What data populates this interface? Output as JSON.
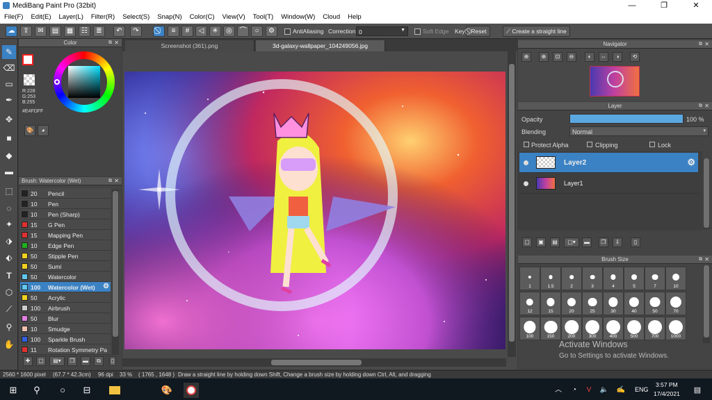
{
  "titlebar": {
    "title": "MediBang Paint Pro (32bit)",
    "minimize": "—",
    "maximize": "❐",
    "close": "✕"
  },
  "menu": [
    "File(F)",
    "Edit(E)",
    "Layer(L)",
    "Filter(R)",
    "Select(S)",
    "Snap(N)",
    "Color(C)",
    "View(V)",
    "Tool(T)",
    "Window(W)",
    "Cloud",
    "Help"
  ],
  "toolbar": {
    "antialiasing": "AntiAliasing",
    "correction_label": "Correction",
    "correction_value": "0",
    "soft_edge": "Soft Edge",
    "key_label": "Key",
    "reset": "Reset",
    "create_straight_line": "Create a straight line"
  },
  "color_panel": {
    "title": "Color",
    "r": "R:228",
    "g": "G:253",
    "b": "B:255",
    "hex": "#E4FDFF",
    "current_color": "#e4fdff"
  },
  "brush_panel": {
    "title": "Brush: Watercolor (Wet)",
    "brushes": [
      {
        "size": "20",
        "name": "Pencil",
        "color": "#222222"
      },
      {
        "size": "10",
        "name": "Pen",
        "color": "#222222"
      },
      {
        "size": "10",
        "name": "Pen (Sharp)",
        "color": "#222222"
      },
      {
        "size": "15",
        "name": "G Pen",
        "color": "#e03030"
      },
      {
        "size": "15",
        "name": "Mapping Pen",
        "color": "#e03030"
      },
      {
        "size": "10",
        "name": "Edge Pen",
        "color": "#20b020"
      },
      {
        "size": "50",
        "name": "Stipple Pen",
        "color": "#f0d020"
      },
      {
        "size": "50",
        "name": "Sumi",
        "color": "#f0d020"
      },
      {
        "size": "50",
        "name": "Watercolor",
        "color": "#60c8f0"
      },
      {
        "size": "100",
        "name": "Watercolor (Wet)",
        "color": "#60c8f0"
      },
      {
        "size": "50",
        "name": "Acrylic",
        "color": "#f0d020"
      },
      {
        "size": "100",
        "name": "Airbrush",
        "color": "#cccccc"
      },
      {
        "size": "50",
        "name": "Blur",
        "color": "#e080e0"
      },
      {
        "size": "10",
        "name": "Smudge",
        "color": "#f0c0b0"
      },
      {
        "size": "100",
        "name": "Sparkle Brush",
        "color": "#3060e0"
      },
      {
        "size": "11",
        "name": "Rotation Symmetry Pa",
        "color": "#e03030"
      }
    ],
    "selected_index": 9
  },
  "tabs": [
    "Screenshot (361).png",
    "3d-galaxy-wallpaper_104249056.jpg"
  ],
  "navigator": {
    "title": "Navigator"
  },
  "layer_panel": {
    "title": "Layer",
    "opacity_label": "Opacity",
    "opacity_value": "100 %",
    "opacity_percent": 100,
    "blending_label": "Blending",
    "blending_value": "Normal",
    "protect_alpha": "Protect Alpha",
    "clipping": "Clipping",
    "lock": "Lock",
    "layers": [
      "Layer2",
      "Layer1"
    ]
  },
  "brush_size_panel": {
    "title": "Brush Size",
    "sizes": [
      "1",
      "1.5",
      "2",
      "3",
      "4",
      "5",
      "7",
      "10",
      "12",
      "15",
      "20",
      "25",
      "30",
      "40",
      "50",
      "70",
      "100",
      "150",
      "200",
      "300",
      "400",
      "500",
      "700",
      "1000"
    ]
  },
  "watermark": {
    "line1": "Activate Windows",
    "line2": "Go to Settings to activate Windows."
  },
  "statusbar": {
    "dims": "2560 * 1600 pixel",
    "cm": "(67.7 * 42.3cm)",
    "dpi": "96 dpi",
    "zoom": "33 %",
    "coords": "( 1765 , 1648 )",
    "hint": "Draw a straight line by holding down Shift, Change a brush size by holding down Ctrl, Alt, and dragging"
  },
  "taskbar": {
    "lang": "ENG",
    "time": "3:57 PM",
    "date": "17/4/2021"
  }
}
